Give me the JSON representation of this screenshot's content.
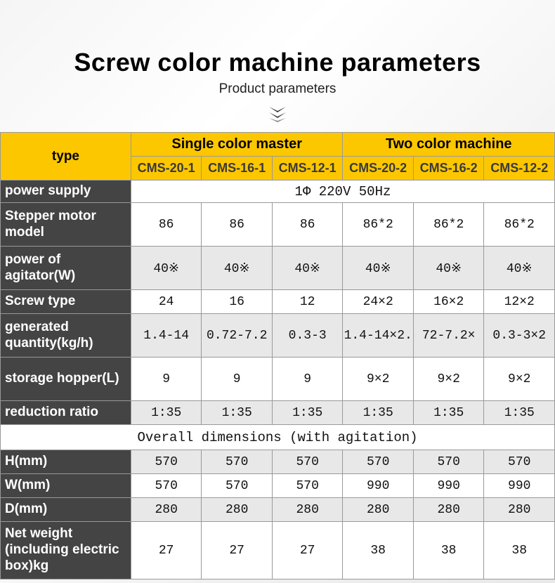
{
  "title": "Screw color machine parameters",
  "subtitle": "Product parameters",
  "header": {
    "type_label": "type",
    "group1": "Single color master",
    "group2": "Two color machine",
    "models": [
      "CMS-20-1",
      "CMS-16-1",
      "CMS-12-1",
      "CMS-20-2",
      "CMS-16-2",
      "CMS-12-2"
    ]
  },
  "rows": {
    "power_supply": {
      "label": "power supply",
      "value": "1Φ 220V 50Hz"
    },
    "stepper": {
      "label": "Stepper motor model",
      "values": [
        "86",
        "86",
        "86",
        "86*2",
        "86*2",
        "86*2"
      ]
    },
    "agitator": {
      "label": "power of agitator(W)",
      "values": [
        "40※",
        "40※",
        "40※",
        "40※",
        "40※",
        "40※"
      ]
    },
    "screw_type": {
      "label": "Screw type",
      "values": [
        "24",
        "16",
        "12",
        "24×2",
        "16×2",
        "12×2"
      ]
    },
    "generated": {
      "label": "generated quantity(kg/h)",
      "values": [
        "1.4-14",
        "0.72-7.2",
        "0.3-3",
        "1.4-14×2.",
        "72-7.2×",
        "0.3-3×2"
      ]
    },
    "hopper": {
      "label": "storage hopper(L)",
      "values": [
        "9",
        "9",
        "9",
        "9×2",
        "9×2",
        "9×2"
      ]
    },
    "reduction": {
      "label": "reduction ratio",
      "values": [
        "1:35",
        "1:35",
        "1:35",
        "1:35",
        "1:35",
        "1:35"
      ]
    },
    "section_dims": "Overall dimensions (with agitation)",
    "h": {
      "label": "H(mm)",
      "values": [
        "570",
        "570",
        "570",
        "570",
        "570",
        "570"
      ]
    },
    "w": {
      "label": "W(mm)",
      "values": [
        "570",
        "570",
        "570",
        "990",
        "990",
        "990"
      ]
    },
    "d": {
      "label": "D(mm)",
      "values": [
        "280",
        "280",
        "280",
        "280",
        "280",
        "280"
      ]
    },
    "weight": {
      "label": "Net weight (including electric box)kg",
      "values": [
        "27",
        "27",
        "27",
        "38",
        "38",
        "38"
      ]
    }
  }
}
